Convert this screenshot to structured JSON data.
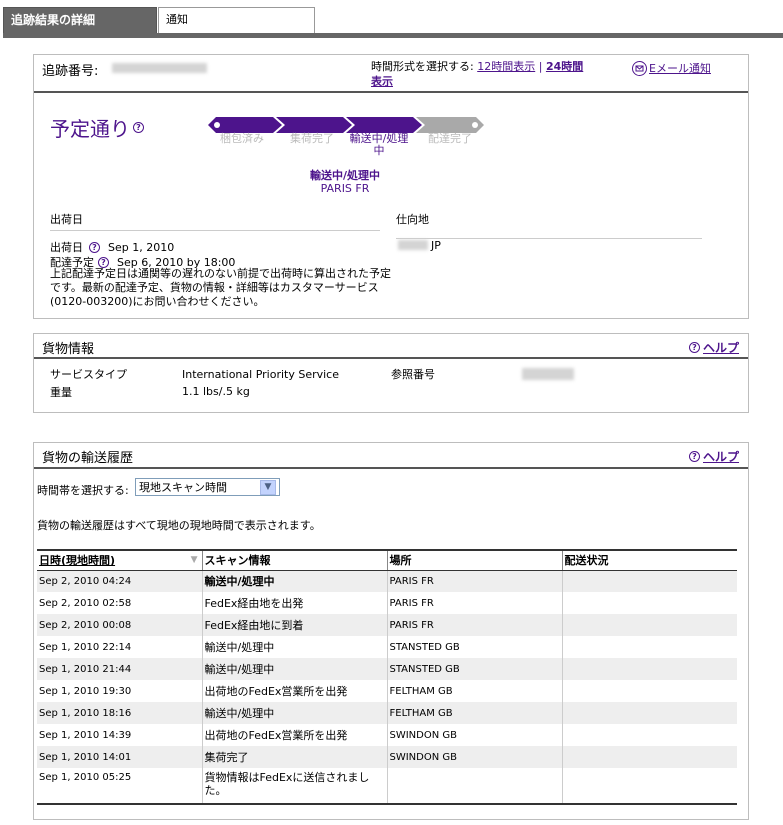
{
  "tabs": [
    {
      "label": "追跡結果の詳細"
    },
    {
      "label": "通知"
    }
  ],
  "tracking": {
    "number_label": "追跡番号:",
    "time_format_prefix": "時間形式を選択する:",
    "time_12h": "12時間表示",
    "separator": "|",
    "time_24h_line1": "24時間",
    "time_24h_line2": "表示",
    "email_notify": "Eメール通知"
  },
  "status": {
    "headline": "予定通り",
    "help_glyph": "?",
    "steps": [
      {
        "label": "梱包済み"
      },
      {
        "label": "集荷完了"
      },
      {
        "label": "輸送中/処理\n中"
      },
      {
        "label": "配達完了"
      }
    ],
    "current_status": "輸送中/処理中",
    "current_location": "PARIS FR"
  },
  "shipment": {
    "origin_header": "出荷日",
    "destination_header": "仕向地",
    "ship_date_label": "出荷日",
    "ship_date": "Sep 1, 2010",
    "delivery_label": "配達予定",
    "delivery_date": "Sep 6, 2010 by 18:00",
    "note": "上記配達予定日は通関等の遅れのない前提で出荷時に算出された予定です。最新の配達予定、貨物の情報・詳細等はカスタマーサービス(0120-003200)にお問い合わせください。",
    "destination_suffix": "JP"
  },
  "cargo": {
    "title": "貨物情報",
    "help": "ヘルプ",
    "service_type_label": "サービスタイプ",
    "service_type": "International Priority Service",
    "weight_label": "重量",
    "weight": "1.1 lbs/.5 kg",
    "reference_label": "参照番号"
  },
  "history": {
    "title": "貨物の輸送履歴",
    "help": "ヘルプ",
    "timezone_label": "時間帯を選択する:",
    "timezone_value": "現地スキャン時間",
    "timezone_note": "貨物の輸送履歴はすべて現地の現地時間で表示されます。",
    "columns": [
      "日時(現地時間)",
      "スキャン情報",
      "場所",
      "配送状況"
    ],
    "rows": [
      {
        "datetime": "Sep 2, 2010 04:24",
        "scan": "輸送中/処理中",
        "location": "PARIS FR",
        "status": ""
      },
      {
        "datetime": "Sep 2, 2010 02:58",
        "scan": "FedEx経由地を出発",
        "location": "PARIS FR",
        "status": ""
      },
      {
        "datetime": "Sep 2, 2010 00:08",
        "scan": "FedEx経由地に到着",
        "location": "PARIS FR",
        "status": ""
      },
      {
        "datetime": "Sep 1, 2010 22:14",
        "scan": "輸送中/処理中",
        "location": "STANSTED GB",
        "status": ""
      },
      {
        "datetime": "Sep 1, 2010 21:44",
        "scan": "輸送中/処理中",
        "location": "STANSTED GB",
        "status": ""
      },
      {
        "datetime": "Sep 1, 2010 19:30",
        "scan": "出荷地のFedEx営業所を出発",
        "location": "FELTHAM GB",
        "status": ""
      },
      {
        "datetime": "Sep 1, 2010 18:16",
        "scan": "輸送中/処理中",
        "location": "FELTHAM GB",
        "status": ""
      },
      {
        "datetime": "Sep 1, 2010 14:39",
        "scan": "出荷地のFedEx営業所を出発",
        "location": "SWINDON GB",
        "status": ""
      },
      {
        "datetime": "Sep 1, 2010 14:01",
        "scan": "集荷完了",
        "location": "SWINDON GB",
        "status": ""
      },
      {
        "datetime": "Sep 1, 2010 05:25",
        "scan": "貨物情報はFedExに送信されました。",
        "location": "",
        "status": ""
      }
    ]
  },
  "colors": {
    "brand_purple": "#4d148c",
    "tab_grey": "#666666",
    "progress_grey": "#a9a9a9"
  },
  "icons": {
    "help": "help-circle-icon",
    "email": "envelope-icon",
    "sort": "sort-down-icon",
    "dropdown": "chevron-down-icon"
  }
}
